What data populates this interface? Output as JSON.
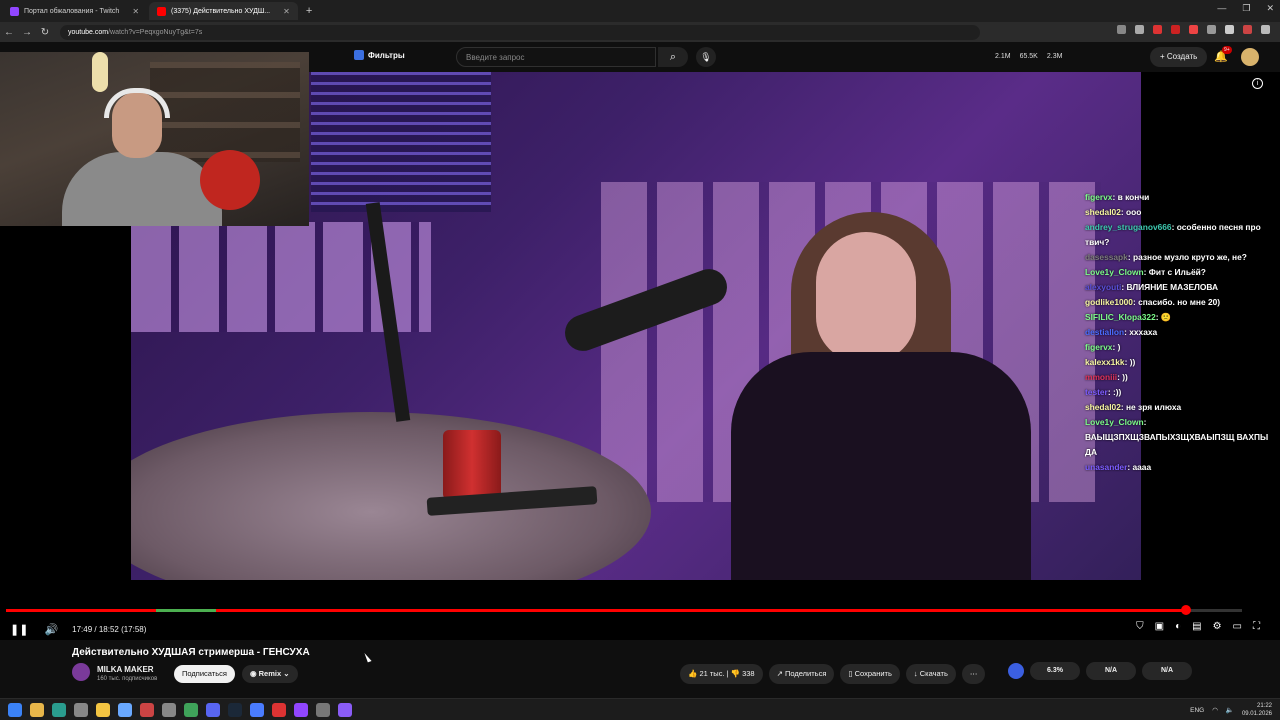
{
  "browser": {
    "tabs": [
      {
        "title": "Портал обжалования - Twitch",
        "active": false,
        "color": "#9146ff"
      },
      {
        "title": "(3375) Действительно ХУДШ...",
        "active": true,
        "color": "#ff0000"
      }
    ],
    "url_domain": "youtube.com",
    "url_path": "/watch?v=PeqxgoNuyTg&t=7s"
  },
  "header": {
    "filters_label": "Фильтры",
    "search_placeholder": "Введите запрос",
    "stats": [
      "2.1M",
      "65.5K",
      "2.3M"
    ],
    "create_label": "Создать",
    "notifications_badge": "9+"
  },
  "chat": [
    {
      "user": "figervx",
      "color": "#7cfc8a",
      "text": "в кончи"
    },
    {
      "user": "shedal02",
      "color": "#f5f5a0",
      "text": "ооо"
    },
    {
      "user": "andrey_struganov666",
      "color": "#3dc9b0",
      "text": "особенно песня про твич?"
    },
    {
      "user": "dasessapk",
      "color": "#7c7c7c",
      "text": "разное музло круто же, не?"
    },
    {
      "user": "Love1y_Clown",
      "color": "#7cfc8a",
      "text": "Фит с Ильёй?"
    },
    {
      "user": "alexyouti",
      "color": "#5a4fd8",
      "text": "ВЛИЯНИЕ МАЗЕЛОВА"
    },
    {
      "user": "godlike1000",
      "color": "#f5f5a0",
      "text": "спасибо. но мне 20)"
    },
    {
      "user": "SIFILIC_Klopa322",
      "color": "#7cfc8a",
      "text": "🙁"
    },
    {
      "user": "destiallon",
      "color": "#4a6cff",
      "text": "хххаха"
    },
    {
      "user": "figervx",
      "color": "#7cfc8a",
      "text": ")"
    },
    {
      "user": "kalexx1kk",
      "color": "#f5f5a0",
      "text": "))"
    },
    {
      "user": "mmoniii",
      "color": "#e0325a",
      "text": "))"
    },
    {
      "user": "tester",
      "color": "#7c5cff",
      "text": ":))"
    },
    {
      "user": "shedal02",
      "color": "#f5f5a0",
      "text": "не зря илюха"
    },
    {
      "user": "Love1y_Clown",
      "color": "#7cfc8a",
      "text": "ВАЫЩЗПХЩЗВАПЫХЗЩХВАЫПЗЩ ВАХПЫ ДА"
    },
    {
      "user": "unasander",
      "color": "#7c5cff",
      "text": "аааа"
    }
  ],
  "player": {
    "time_label": "17:49 / 18:52 (17:58)",
    "progress": 0.955,
    "video_title": "Действительно ХУДШАЯ стримерша - ГЕНСУХА"
  },
  "channel": {
    "name": "MILKA MAKER",
    "subscribers": "160 тыс. подписчиков",
    "subscribe_label": "Подписаться",
    "remix_label": "Remix"
  },
  "actions": {
    "likes": "21 тыс.",
    "dislikes": "338",
    "share": "Поделиться",
    "save": "Сохранить",
    "download": "Скачать"
  },
  "ratings": [
    "6.3%",
    "N/A",
    "N/A"
  ],
  "taskbar": {
    "lang": "ENG",
    "time": "21:22",
    "date": "09.01.2026"
  }
}
